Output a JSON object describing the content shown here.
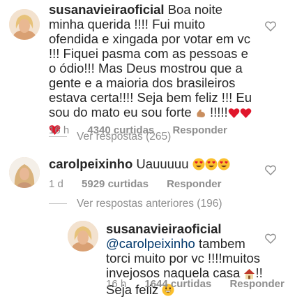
{
  "comments": [
    {
      "username": "susanavieiraoficial",
      "text": "Boa noite minha querida !!!! Fui muito ofendida e xingada por votar em vc !!! Fiquei pasma com as pessoas e o ódio!!! Mas Deus mostrou que a gente e a maioria dos brasileiros estava certa!!!! Seja bem feliz !!! Eu sou do mato eu sou forte",
      "text_end": "!!!!!",
      "time": "16 h",
      "likes": "4340 curtidas",
      "reply": "Responder",
      "emoji_names": [
        "flexed-biceps",
        "red-heart",
        "red-heart",
        "red-heart"
      ]
    },
    {
      "username": "carolpeixinho",
      "text": "Uauuuuu",
      "time": "1 d",
      "likes": "5929 curtidas",
      "reply": "Responder",
      "emoji_names": [
        "heart-eyes",
        "heart-eyes",
        "heart-eyes"
      ]
    },
    {
      "username": "susanavieiraoficial",
      "mention": "@carolpeixinho",
      "text": "tambem torci muito por vc !!!!muitos invejosos naquela casa",
      "text_end": "!! Seja feliz",
      "time": "16 h",
      "likes": "1644 curtidas",
      "reply": "Responder",
      "emoji_names": [
        "house",
        "grinning-face"
      ]
    }
  ],
  "view_replies": "Ver respostas (265)",
  "view_previous": "Ver respostas anteriores (196)",
  "colors": {
    "meta": "#8e8e8e",
    "mention": "#00376b",
    "text": "#262626"
  }
}
